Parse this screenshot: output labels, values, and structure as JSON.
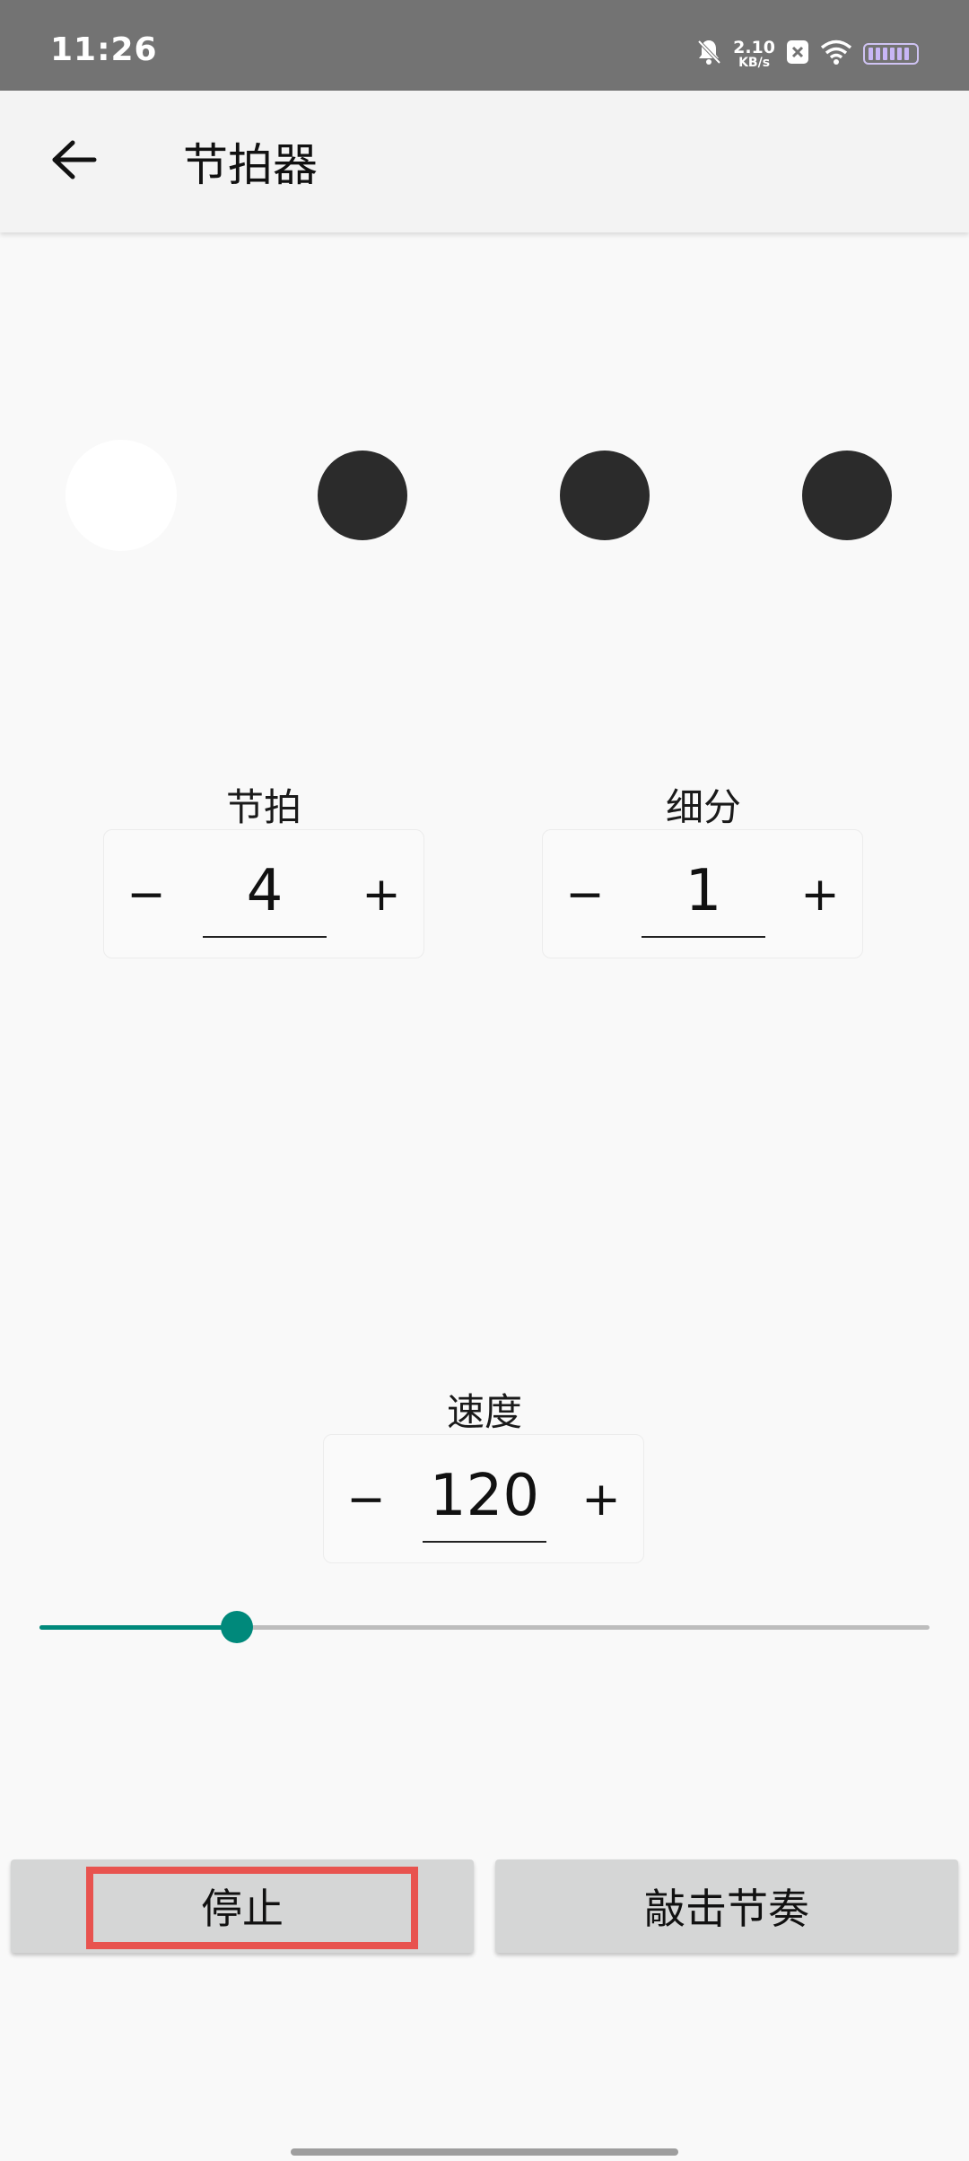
{
  "status_bar": {
    "time": "11:26",
    "net_speed_value": "2.10",
    "net_speed_unit": "KB/s",
    "icons": [
      "bell-muted-icon",
      "notification-box-icon",
      "wifi-icon",
      "battery-icon"
    ]
  },
  "app_bar": {
    "title": "节拍器",
    "back_icon": "arrow-left-icon"
  },
  "beats": {
    "count": 4,
    "active_index": 0
  },
  "beat_stepper": {
    "label": "节拍",
    "minus": "−",
    "value": "4",
    "plus": "+"
  },
  "subdivision_stepper": {
    "label": "细分",
    "minus": "−",
    "value": "1",
    "plus": "+"
  },
  "tempo_stepper": {
    "label": "速度",
    "minus": "−",
    "value": "120",
    "plus": "+"
  },
  "tempo_slider": {
    "fill_fraction": 0.222,
    "accent_color": "#00897b"
  },
  "buttons": {
    "stop_label": "停止",
    "tap_tempo_label": "敲击节奏"
  },
  "colors": {
    "status_bar": "#737373",
    "background": "#f9f9f9",
    "beat_inactive": "#2b2b2b",
    "beat_active": "#ffffff",
    "highlight": "#e8534f"
  }
}
